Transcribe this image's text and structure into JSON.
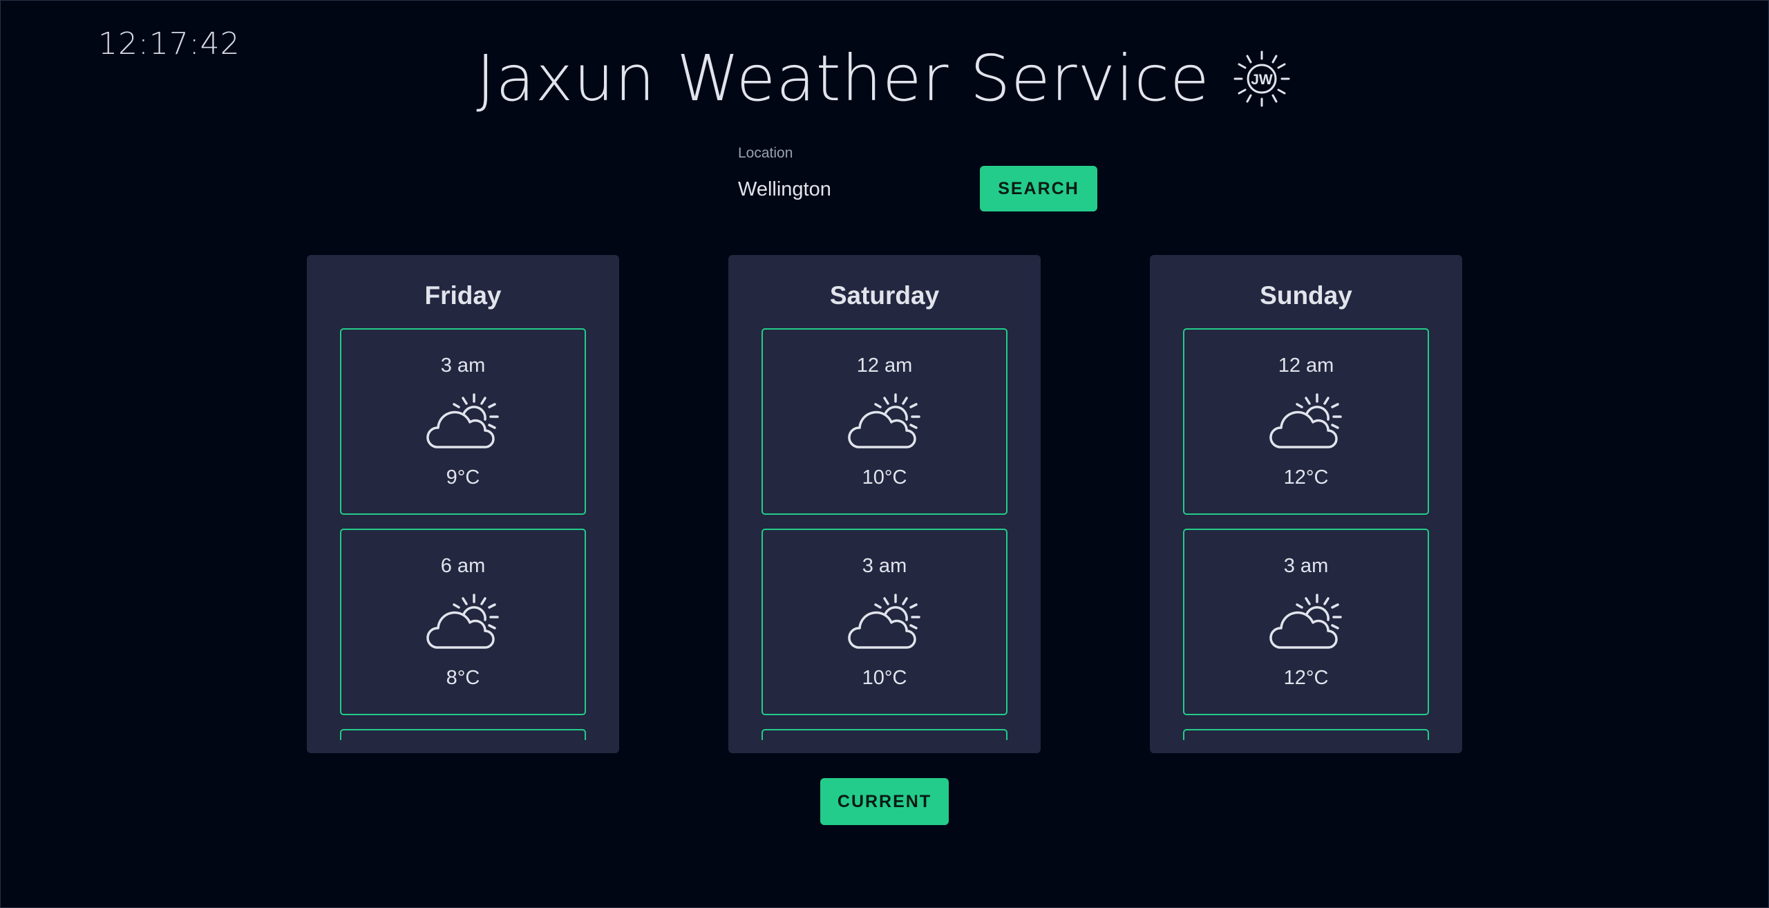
{
  "clock": "12:17:42",
  "header": {
    "title": "Jaxun Weather Service",
    "logo_text": "JW"
  },
  "search": {
    "label": "Location",
    "value": "Wellington",
    "button_label": "SEARCH"
  },
  "days": [
    {
      "name": "Friday",
      "slots": [
        {
          "time": "3 am",
          "icon": "partly-cloudy-icon",
          "temp": "9°C"
        },
        {
          "time": "6 am",
          "icon": "partly-cloudy-icon",
          "temp": "8°C"
        }
      ]
    },
    {
      "name": "Saturday",
      "slots": [
        {
          "time": "12 am",
          "icon": "partly-cloudy-icon",
          "temp": "10°C"
        },
        {
          "time": "3 am",
          "icon": "partly-cloudy-icon",
          "temp": "10°C"
        }
      ]
    },
    {
      "name": "Sunday",
      "slots": [
        {
          "time": "12 am",
          "icon": "partly-cloudy-icon",
          "temp": "12°C"
        },
        {
          "time": "3 am",
          "icon": "partly-cloudy-icon",
          "temp": "12°C"
        }
      ]
    }
  ],
  "current_button_label": "CURRENT",
  "colors": {
    "background": "#010615",
    "card": "#232740",
    "accent": "#23cc8a",
    "text": "#e2e4ec"
  }
}
